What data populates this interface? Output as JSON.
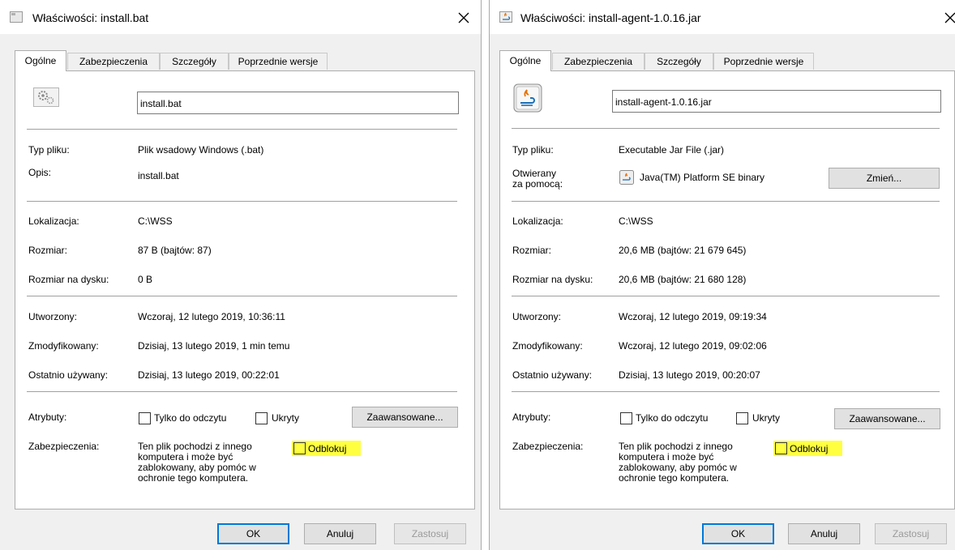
{
  "left": {
    "title": "Właściwości: install.bat",
    "tabs": [
      "Ogólne",
      "Zabezpieczenia",
      "Szczegóły",
      "Poprzednie wersje"
    ],
    "filename": "install.bat",
    "type_label": "Typ pliku:",
    "type_value": "Plik wsadowy Windows (.bat)",
    "desc_label": "Opis:",
    "desc_value": "install.bat",
    "location_label": "Lokalizacja:",
    "location_value": "C:\\WSS",
    "size_label": "Rozmiar:",
    "size_value": "87 B (bajtów: 87)",
    "disk_size_label": "Rozmiar na dysku:",
    "disk_size_value": "0 B",
    "created_label": "Utworzony:",
    "created_value": "Wczoraj, 12 lutego 2019, 10:36:11",
    "modified_label": "Zmodyfikowany:",
    "modified_value": "Dzisiaj, 13 lutego 2019, 1 min temu",
    "accessed_label": "Ostatnio używany:",
    "accessed_value": "Dzisiaj, 13 lutego 2019, 00:22:01",
    "attributes_label": "Atrybuty:",
    "readonly_label": "Tylko do odczytu",
    "hidden_label": "Ukryty",
    "advanced_button": "Zaawansowane...",
    "security_label": "Zabezpieczenia:",
    "security_text": [
      "Ten plik pochodzi z innego",
      "komputera i może być",
      "zablokowany, aby pomóc w",
      "ochronie tego komputera."
    ],
    "unblock_label": "Odblokuj",
    "ok_button": "OK",
    "cancel_button": "Anuluj",
    "apply_button": "Zastosuj"
  },
  "right": {
    "title": "Właściwości: install-agent-1.0.16.jar",
    "tabs": [
      "Ogólne",
      "Zabezpieczenia",
      "Szczegóły",
      "Poprzednie wersje"
    ],
    "filename": "install-agent-1.0.16.jar",
    "type_label": "Typ pliku:",
    "type_value": "Executable Jar File (.jar)",
    "opens_with_label": [
      "Otwierany",
      "za pomocą:"
    ],
    "opens_with_value": "Java(TM) Platform SE binary",
    "change_button": "Zmień...",
    "location_label": "Lokalizacja:",
    "location_value": "C:\\WSS",
    "size_label": "Rozmiar:",
    "size_value": "20,6 MB (bajtów: 21 679 645)",
    "disk_size_label": "Rozmiar na dysku:",
    "disk_size_value": "20,6 MB (bajtów: 21 680 128)",
    "created_label": "Utworzony:",
    "created_value": "Wczoraj, 12 lutego 2019, 09:19:34",
    "modified_label": "Zmodyfikowany:",
    "modified_value": "Wczoraj, 12 lutego 2019, 09:02:06",
    "accessed_label": "Ostatnio używany:",
    "accessed_value": "Dzisiaj, 13 lutego 2019, 00:20:07",
    "attributes_label": "Atrybuty:",
    "readonly_label": "Tylko do odczytu",
    "hidden_label": "Ukryty",
    "advanced_button": "Zaawansowane...",
    "security_label": "Zabezpieczenia:",
    "security_text": [
      "Ten plik pochodzi z innego",
      "komputera i może być",
      "zablokowany, aby pomóc w",
      "ochronie tego komputera."
    ],
    "unblock_label": "Odblokuj",
    "ok_button": "OK",
    "cancel_button": "Anuluj",
    "apply_button": "Zastosuj"
  },
  "colors": {
    "highlight": "#ffff40",
    "ok_border": "#0078d7",
    "separator": "#a0a0a0"
  }
}
